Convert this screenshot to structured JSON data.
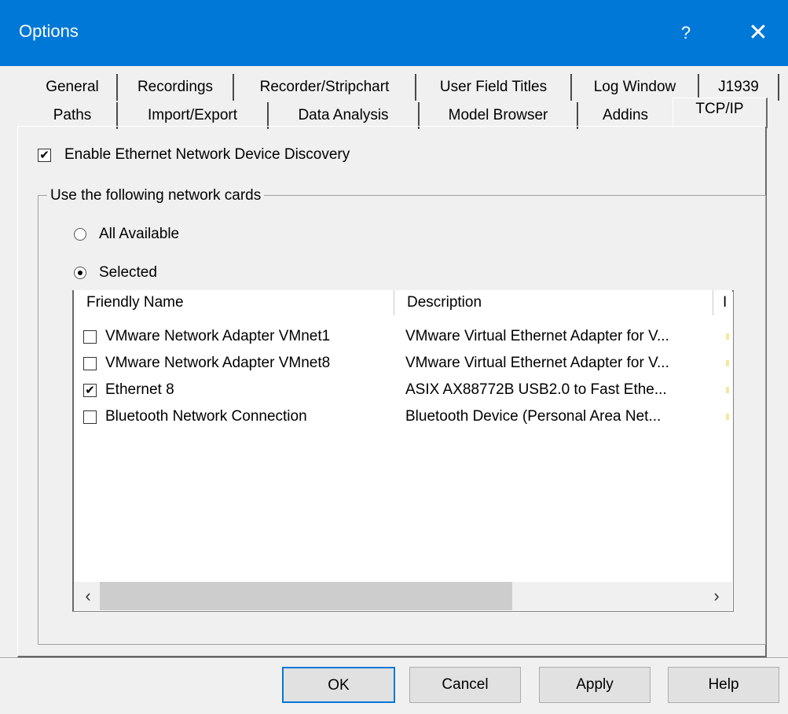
{
  "window": {
    "title": "Options",
    "help_glyph": "?",
    "close_glyph": "✕"
  },
  "tabs_row1": [
    "General",
    "Recordings",
    "Recorder/Stripchart",
    "User Field Titles",
    "Log Window",
    "J1939"
  ],
  "tabs_row2": [
    "Paths",
    "Import/Export",
    "Data Analysis",
    "Model Browser",
    "Addins",
    "TCP/IP"
  ],
  "active_tab": "TCP/IP",
  "discovery": {
    "label": "Enable Ethernet Network Device Discovery",
    "checked": true
  },
  "network_group": {
    "title": "Use the following network cards",
    "option_all": "All Available",
    "option_selected": "Selected",
    "selected_option": "Selected"
  },
  "list": {
    "columns": [
      "Friendly Name",
      "Description",
      "I"
    ],
    "rows": [
      {
        "checked": false,
        "name": "VMware Network Adapter VMnet1",
        "description": "VMware Virtual Ethernet Adapter for V..."
      },
      {
        "checked": false,
        "name": "VMware Network Adapter VMnet8",
        "description": "VMware Virtual Ethernet Adapter for V..."
      },
      {
        "checked": true,
        "name": "Ethernet 8",
        "description": "ASIX AX88772B USB2.0 to Fast Ethe..."
      },
      {
        "checked": false,
        "name": "Bluetooth Network Connection",
        "description": "Bluetooth Device (Personal Area Net..."
      }
    ],
    "scroll_left": "‹",
    "scroll_right": "›"
  },
  "buttons": {
    "ok": "OK",
    "cancel": "Cancel",
    "apply": "Apply",
    "help": "Help"
  },
  "colors": {
    "titlebar": "#0078d7",
    "dialog_bg": "#f0f0f0",
    "default_button_border": "#0078d7"
  }
}
